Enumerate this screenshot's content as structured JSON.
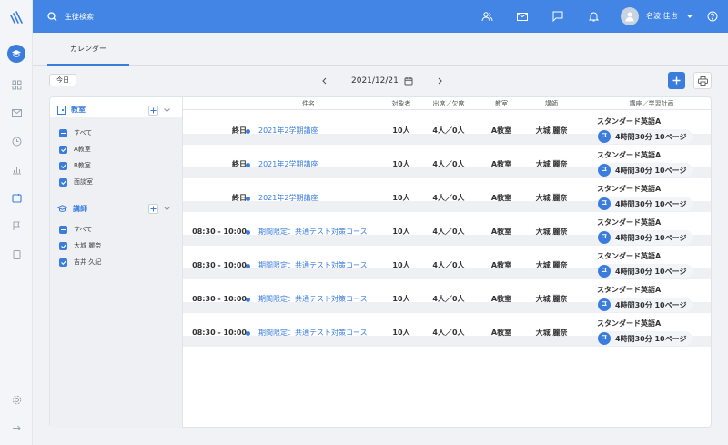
{
  "topbar": {
    "search_placeholder": "生徒検索",
    "user_name": "名波 佳也",
    "icons": [
      "users-icon",
      "mail-icon",
      "chat-icon",
      "bell-icon",
      "help-icon"
    ]
  },
  "tabs": {
    "active": "カレンダー"
  },
  "toolbar": {
    "today": "今日",
    "date": "2021/12/21"
  },
  "filters": {
    "rooms": {
      "title": "教室",
      "items": [
        "すべて",
        "A教室",
        "B教室",
        "面談室"
      ]
    },
    "teachers": {
      "title": "講師",
      "items": [
        "すべて",
        "大城 麗奈",
        "吉井 久紀"
      ]
    }
  },
  "table": {
    "headers": {
      "subject": "件名",
      "target": "対象者",
      "attendance": "出席／欠席",
      "room": "教室",
      "teacher": "講師",
      "plan": "講座／学習計画"
    },
    "rows": [
      {
        "time": "終日",
        "title": "2021年2学期講座",
        "target": "10人",
        "attendance": "4人／0人",
        "room": "A教室",
        "teacher": "大城 麗奈",
        "course": "スタンダード英語A",
        "plan": "4時間30分  10ページ"
      },
      {
        "time": "終日",
        "title": "2021年2学期講座",
        "target": "10人",
        "attendance": "4人／0人",
        "room": "A教室",
        "teacher": "大城 麗奈",
        "course": "スタンダード英語A",
        "plan": "4時間30分  10ページ"
      },
      {
        "time": "終日",
        "title": "2021年2学期講座",
        "target": "10人",
        "attendance": "4人／0人",
        "room": "A教室",
        "teacher": "大城 麗奈",
        "course": "スタンダード英語A",
        "plan": "4時間30分  10ページ"
      },
      {
        "time": "08:30 - 10:00",
        "title": "期間限定：共通テスト対策コース",
        "target": "10人",
        "attendance": "4人／0人",
        "room": "A教室",
        "teacher": "大城 麗奈",
        "course": "スタンダード英語A",
        "plan": "4時間30分  10ページ"
      },
      {
        "time": "08:30 - 10:00",
        "title": "期間限定：共通テスト対策コース",
        "target": "10人",
        "attendance": "4人／0人",
        "room": "A教室",
        "teacher": "大城 麗奈",
        "course": "スタンダード英語A",
        "plan": "4時間30分  10ページ"
      },
      {
        "time": "08:30 - 10:00",
        "title": "期間限定：共通テスト対策コース",
        "target": "10人",
        "attendance": "4人／0人",
        "room": "A教室",
        "teacher": "大城 麗奈",
        "course": "スタンダード英語A",
        "plan": "4時間30分  10ページ"
      },
      {
        "time": "08:30 - 10:00",
        "title": "期間限定：共通テスト対策コース",
        "target": "10人",
        "attendance": "4人／0人",
        "room": "A教室",
        "teacher": "大城 麗奈",
        "course": "スタンダード英語A",
        "plan": "4時間30分  10ページ"
      }
    ]
  },
  "colors": {
    "primary": "#4285e4",
    "accent": "#3b7ddd",
    "background": "#f0f2f6"
  }
}
